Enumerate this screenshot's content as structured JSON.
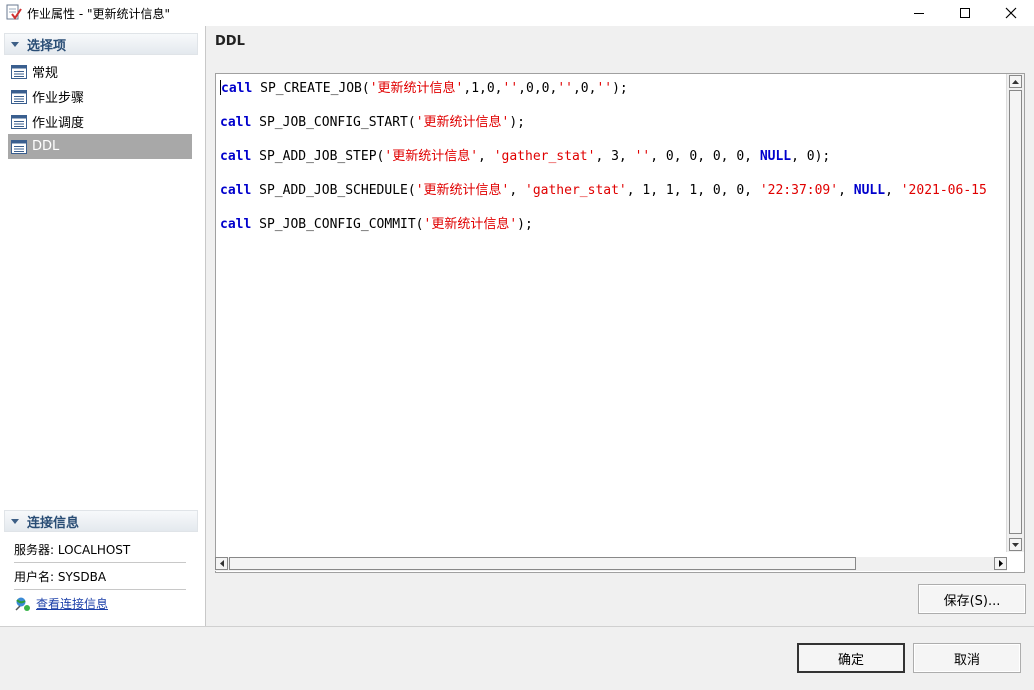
{
  "window": {
    "title": "作业属性 - \"更新统计信息\"",
    "icon": "job-properties-icon"
  },
  "left": {
    "options_header": "选择项",
    "nav_items": [
      {
        "label": "常规",
        "icon": "list-icon",
        "selected": false
      },
      {
        "label": "作业步骤",
        "icon": "list-icon",
        "selected": false
      },
      {
        "label": "作业调度",
        "icon": "list-icon",
        "selected": false
      },
      {
        "label": "DDL",
        "icon": "list-icon",
        "selected": true
      }
    ],
    "connection_header": "连接信息",
    "server_label": "服务器: LOCALHOST",
    "user_label": "用户名: SYSDBA",
    "view_connection_link": "查看连接信息"
  },
  "right": {
    "title": "DDL",
    "code_lines": [
      {
        "keyword": "call",
        "name": " SP_CREATE_JOB(",
        "parts": [
          [
            "str",
            "'更新统计信息'"
          ],
          [
            "plain",
            ",1,0,"
          ],
          [
            "str",
            "''"
          ],
          [
            "plain",
            ",0,0,"
          ],
          [
            "str",
            "''"
          ],
          [
            "plain",
            ",0,"
          ],
          [
            "str",
            "''"
          ],
          [
            "plain",
            ");"
          ]
        ]
      },
      {
        "keyword": "call",
        "name": " SP_JOB_CONFIG_START(",
        "parts": [
          [
            "str",
            "'更新统计信息'"
          ],
          [
            "plain",
            ");"
          ]
        ]
      },
      {
        "keyword": "call",
        "name": " SP_ADD_JOB_STEP(",
        "parts": [
          [
            "str",
            "'更新统计信息'"
          ],
          [
            "plain",
            ", "
          ],
          [
            "str",
            "'gather_stat'"
          ],
          [
            "plain",
            ", 3, "
          ],
          [
            "str",
            "''"
          ],
          [
            "plain",
            ", 0, 0, 0, 0, "
          ],
          [
            "kw",
            "NULL"
          ],
          [
            "plain",
            ", 0);"
          ]
        ]
      },
      {
        "keyword": "call",
        "name": " SP_ADD_JOB_SCHEDULE(",
        "parts": [
          [
            "str",
            "'更新统计信息'"
          ],
          [
            "plain",
            ", "
          ],
          [
            "str",
            "'gather_stat'"
          ],
          [
            "plain",
            ", 1, 1, 1, 0, 0, "
          ],
          [
            "str",
            "'22:37:09'"
          ],
          [
            "plain",
            ", "
          ],
          [
            "kw",
            "NULL"
          ],
          [
            "plain",
            ", "
          ],
          [
            "str",
            "'2021-06-15"
          ]
        ]
      },
      {
        "keyword": "call",
        "name": " SP_JOB_CONFIG_COMMIT(",
        "parts": [
          [
            "str",
            "'更新统计信息'"
          ],
          [
            "plain",
            ");"
          ]
        ]
      }
    ],
    "save_button": "保存(S)..."
  },
  "footer": {
    "ok_button": "确定",
    "cancel_button": "取消"
  },
  "colors": {
    "keyword": "#0000cc",
    "string": "#e00000",
    "selected_nav": "#a8a8a8",
    "header_text": "#294d75",
    "link": "#1b3fa8"
  }
}
